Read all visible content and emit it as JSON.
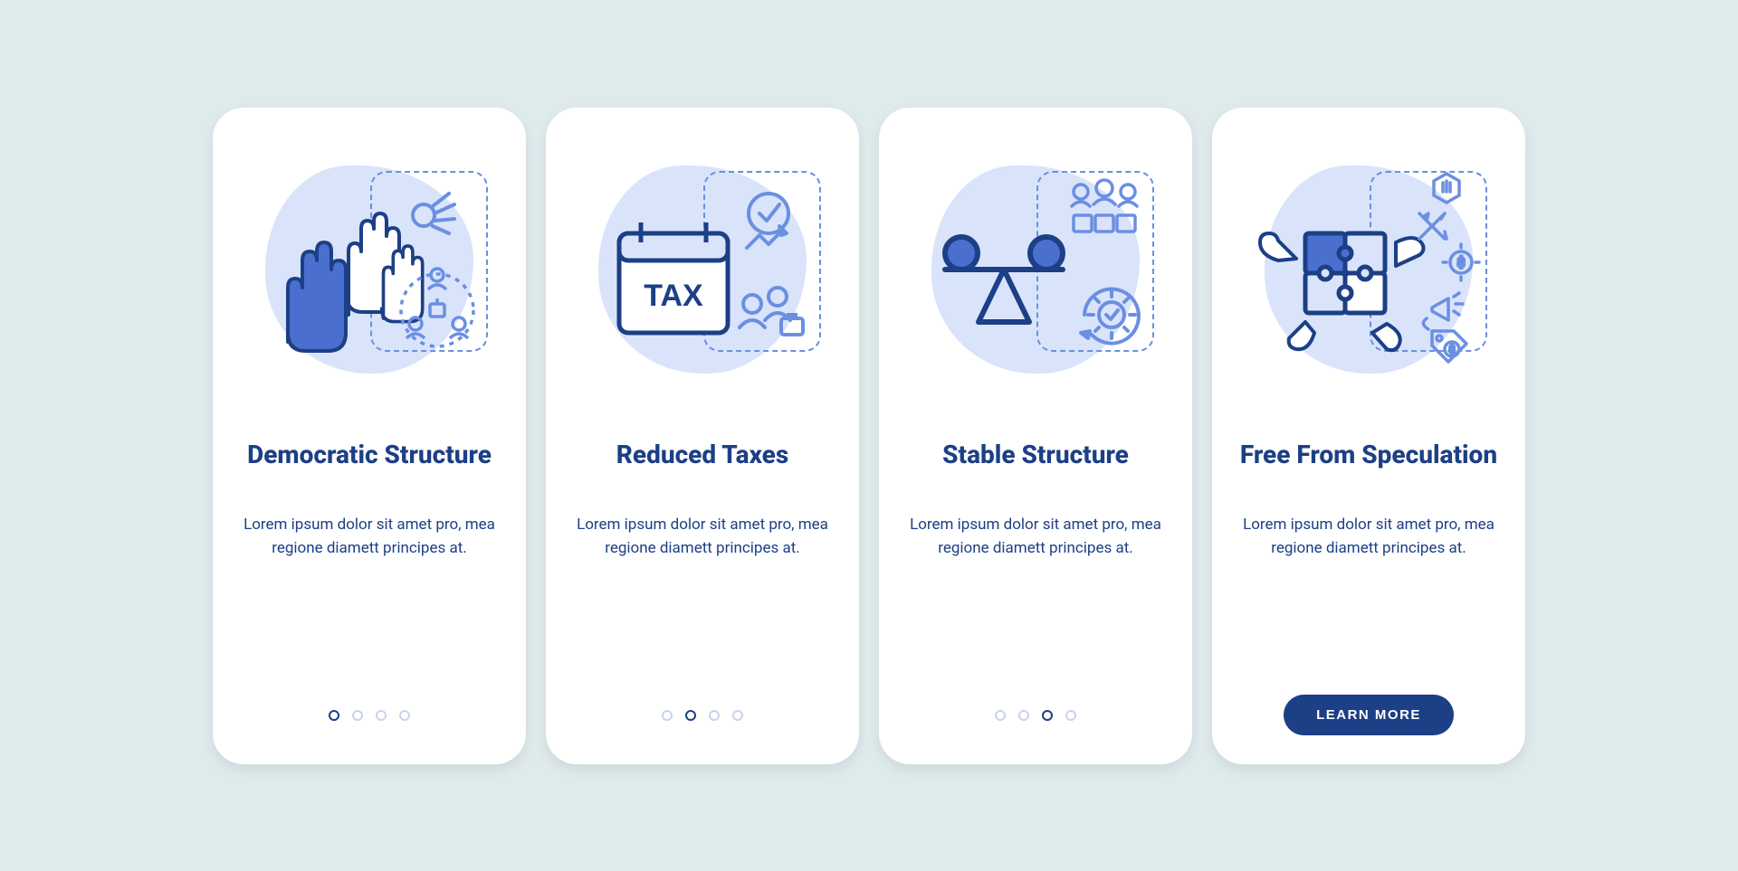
{
  "colors": {
    "bg": "#dfeaed",
    "card": "#ffffff",
    "primary": "#1c3f86",
    "light_blue": "#d9e4fb",
    "mid_blue": "#6b8fe1",
    "fill_blue": "#4a6fcf"
  },
  "cards": [
    {
      "icon": "hands-raised-icon",
      "title": "Democratic Structure",
      "desc": "Lorem ipsum dolor sit amet pro, mea regione diamett principes at.",
      "dot_count": 4,
      "active_dot": 0,
      "has_cta": false
    },
    {
      "icon": "tax-calendar-icon",
      "title": "Reduced Taxes",
      "desc": "Lorem ipsum dolor sit amet pro, mea regione diamett principes at.",
      "dot_count": 4,
      "active_dot": 1,
      "has_cta": false
    },
    {
      "icon": "balance-scale-icon",
      "title": "Stable Structure",
      "desc": "Lorem ipsum dolor sit amet pro, mea regione diamett principes at.",
      "dot_count": 4,
      "active_dot": 2,
      "has_cta": false
    },
    {
      "icon": "puzzle-hands-icon",
      "title": "Free From Speculation",
      "desc": "Lorem ipsum dolor sit amet pro, mea regione diamett principes at.",
      "has_cta": true,
      "cta_label": "LEARN MORE"
    }
  ],
  "illus_text": {
    "tax": "TAX"
  }
}
